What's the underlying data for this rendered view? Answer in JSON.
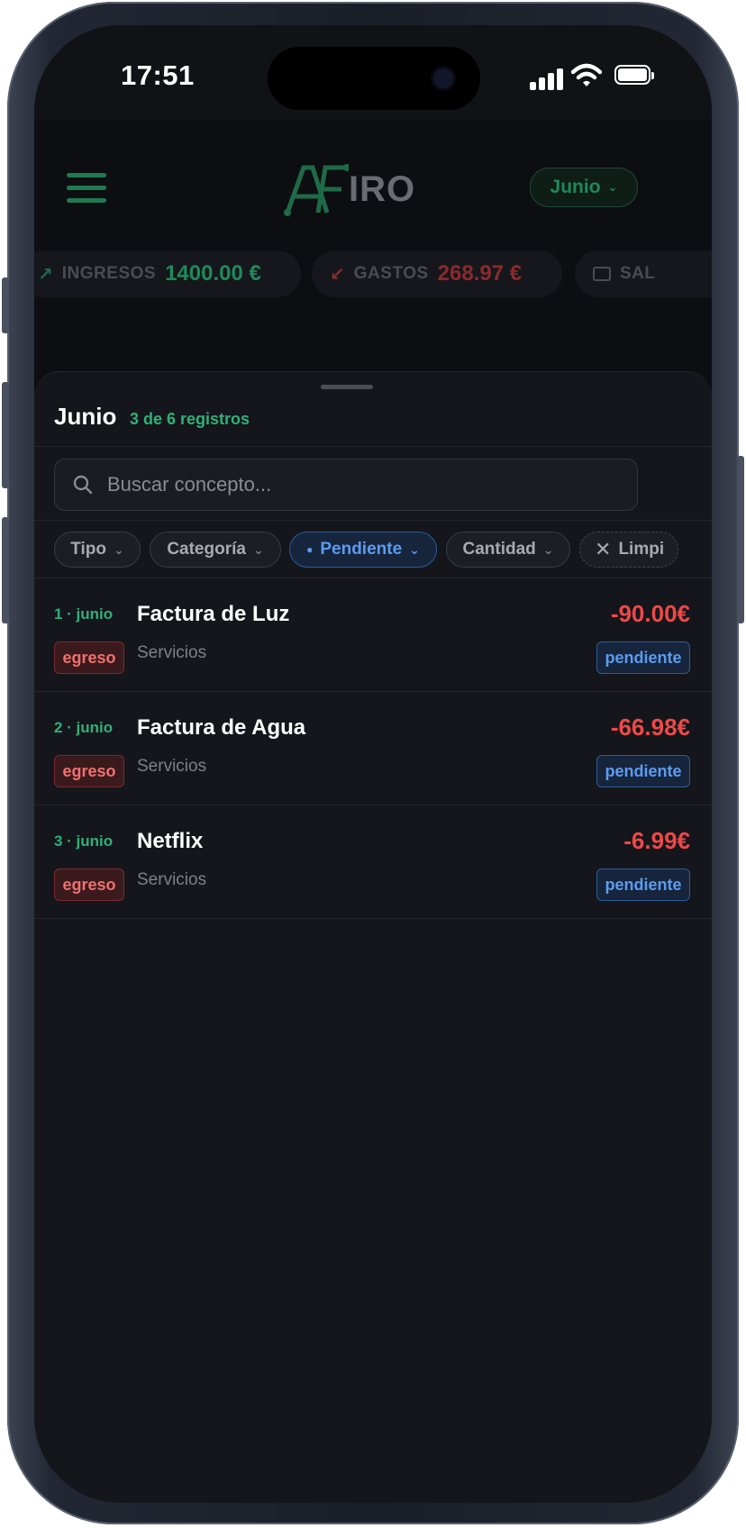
{
  "status_bar": {
    "time": "17:51"
  },
  "header": {
    "logo_text": "IRO",
    "month_selector": "Junio",
    "stats": [
      {
        "label": "INGRESOS",
        "value": "1400.00 €",
        "color": "#1f8a5a"
      },
      {
        "label": "GASTOS",
        "value": "268.97 €",
        "color": "#8a2a2c"
      },
      {
        "label": "SAL",
        "value": ""
      }
    ]
  },
  "sheet": {
    "title": "Junio",
    "count": "3 de 6 registros",
    "search": {
      "placeholder": "Buscar concepto...",
      "value": ""
    },
    "filters": {
      "tipo": "Tipo",
      "categoria": "Categoría",
      "pendiente": "Pendiente",
      "cantidad": "Cantidad",
      "limpiar": "Limpi"
    },
    "rows": [
      {
        "date": "1 · junio",
        "concept": "Factura de Luz",
        "type": "egreso",
        "category": "Servicios",
        "amount": "-90.00€",
        "status": "pendiente"
      },
      {
        "date": "2 · junio",
        "concept": "Factura de Agua",
        "type": "egreso",
        "category": "Servicios",
        "amount": "-66.98€",
        "status": "pendiente"
      },
      {
        "date": "3 · junio",
        "concept": "Netflix",
        "type": "egreso",
        "category": "Servicios",
        "amount": "-6.99€",
        "status": "pendiente"
      }
    ]
  },
  "colors": {
    "accent_green": "#2fb07a",
    "expense_red": "#ef4848",
    "pending_blue": "#5b9cf0",
    "background": "#111216"
  }
}
